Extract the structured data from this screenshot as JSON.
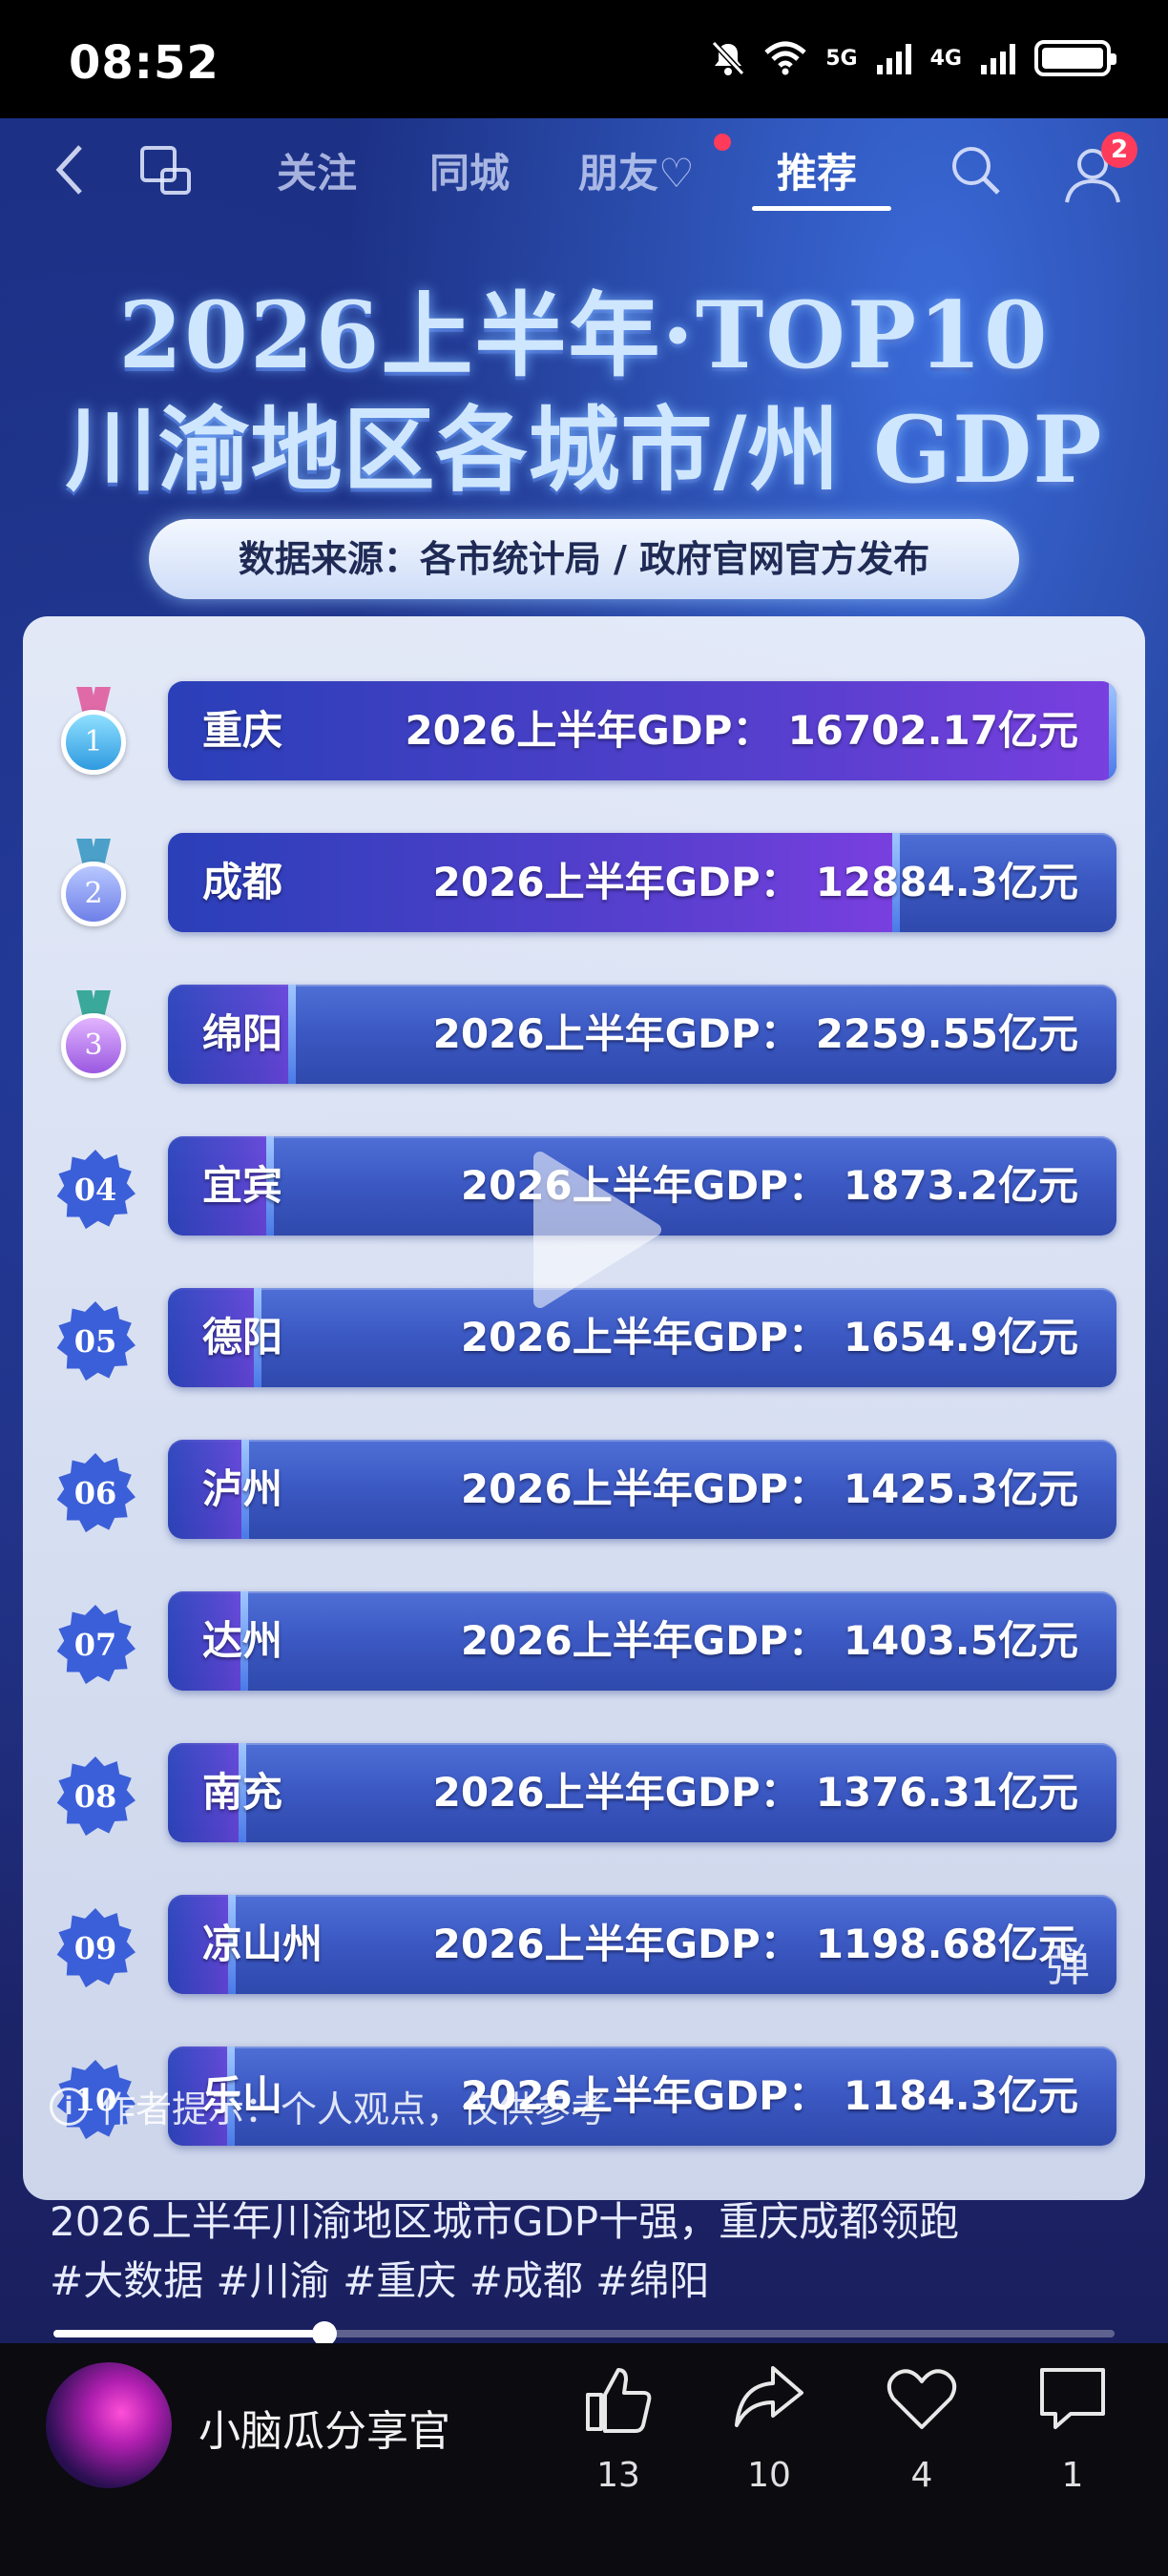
{
  "status_bar": {
    "time": "08:52",
    "net1": "5G",
    "net2": "4G"
  },
  "nav": {
    "tabs": [
      "关注",
      "同城",
      "朋友♡",
      "推荐"
    ],
    "active_tab": "推荐",
    "profile_badge": "2"
  },
  "content": {
    "title_line1": "2026上半年·TOP10",
    "title_line2": "川渝地区各城市/州 GDP",
    "source": "数据来源：各市统计局 / 政府官网官方发布",
    "gdp_prefix": "2026上半年GDP：",
    "unit": "亿元",
    "ranks": [
      {
        "rank": "1",
        "city": "重庆",
        "value": "16702.17"
      },
      {
        "rank": "2",
        "city": "成都",
        "value": "12884.3"
      },
      {
        "rank": "3",
        "city": "绵阳",
        "value": "2259.55"
      },
      {
        "rank": "04",
        "city": "宜宾",
        "value": "1873.2"
      },
      {
        "rank": "05",
        "city": "德阳",
        "value": "1654.9"
      },
      {
        "rank": "06",
        "city": "泸州",
        "value": "1425.3"
      },
      {
        "rank": "07",
        "city": "达州",
        "value": "1403.5"
      },
      {
        "rank": "08",
        "city": "南充",
        "value": "1376.31"
      },
      {
        "rank": "09",
        "city": "凉山州",
        "value": "1198.68"
      },
      {
        "rank": "10",
        "city": "乐山",
        "value": "1184.3"
      }
    ],
    "tip_icon": "i",
    "tip": "作者提示：个人观点，仅供参考",
    "danmu_label": "弹"
  },
  "caption": {
    "line1": "2026上半年川渝地区城市GDP十强，重庆成都领跑",
    "line2": "#大数据 #川渝 #重庆 #成都 #绵阳"
  },
  "progress": {
    "fraction": 0.255
  },
  "bottom": {
    "author": "小脑瓜分享官",
    "like_count": "13",
    "share_count": "10",
    "fav_count": "4",
    "comment_count": "1"
  },
  "colors": {
    "accent": "#ff3b5c",
    "bar": "#3b58c2",
    "fill": "#7a3fe0"
  }
}
